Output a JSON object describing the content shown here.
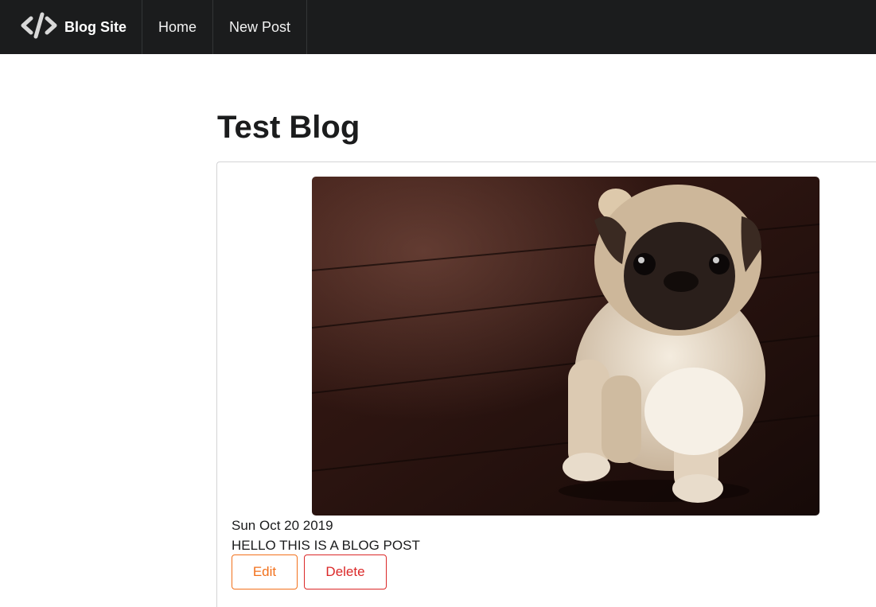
{
  "nav": {
    "brand_icon": "code-icon",
    "brand_label": "Blog Site",
    "items": [
      {
        "label": "Home"
      },
      {
        "label": "New Post"
      }
    ]
  },
  "post": {
    "title": "Test Blog",
    "image_subject": "pug puppy standing on wooden floor",
    "date": "Sun Oct 20 2019",
    "body": "HELLO THIS IS A BLOG POST",
    "edit_label": "Edit",
    "delete_label": "Delete"
  },
  "colors": {
    "navbar": "#1b1c1d",
    "edit": "#f2711c",
    "delete": "#db2828"
  }
}
